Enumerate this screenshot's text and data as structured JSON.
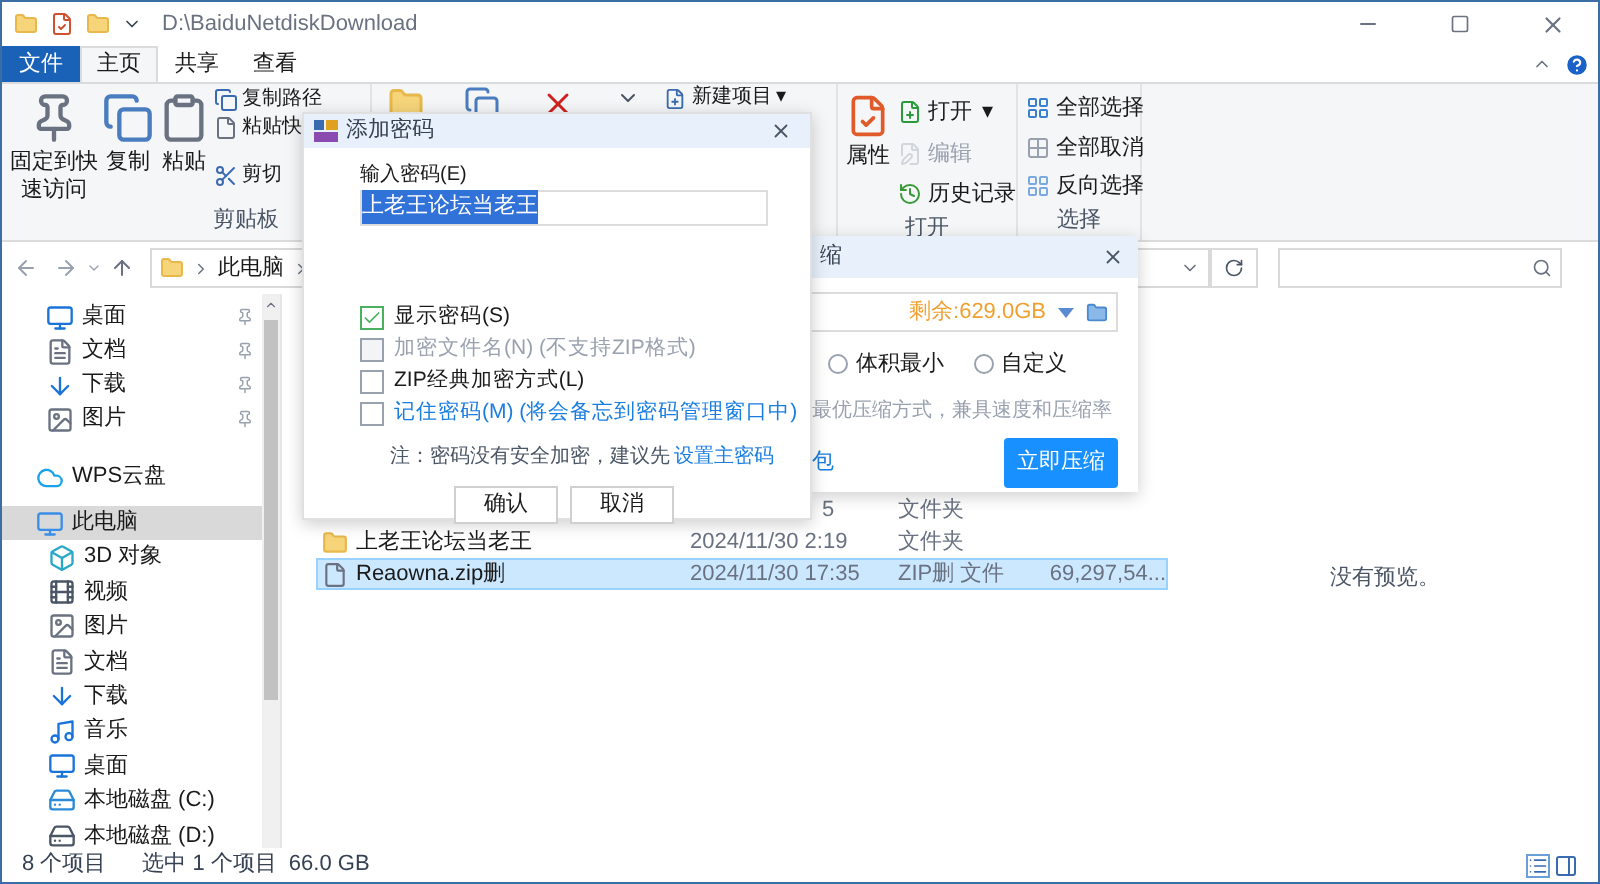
{
  "window": {
    "path": "D:\\BaiduNetdiskDownload"
  },
  "tabs": [
    {
      "label": "文件",
      "kind": "file",
      "selected": false
    },
    {
      "label": "主页",
      "kind": "tab",
      "selected": true
    },
    {
      "label": "共享",
      "kind": "tab",
      "selected": false
    },
    {
      "label": "查看",
      "kind": "tab",
      "selected": false
    }
  ],
  "ribbon": {
    "clipboard": {
      "label": "剪贴板",
      "large": [
        {
          "label": "固定到快速访问",
          "kind": "pin"
        },
        {
          "label": "复制",
          "kind": "copy"
        },
        {
          "label": "粘贴",
          "kind": "paste"
        }
      ],
      "small": [
        {
          "label": "复制路径",
          "kind": "path"
        },
        {
          "label": "粘贴快",
          "kind": "shortcut"
        },
        {
          "label": "剪切",
          "kind": "cut"
        }
      ]
    },
    "new_item": {
      "label": "新建项目",
      "caret": "▾"
    },
    "open": {
      "label": "打开",
      "properties": "属性",
      "items": [
        {
          "label": "打开",
          "kind": "open",
          "caret": "▾",
          "disabled": false
        },
        {
          "label": "编辑",
          "kind": "edit",
          "disabled": true
        },
        {
          "label": "历史记录",
          "kind": "history",
          "disabled": false
        }
      ]
    },
    "select": {
      "label": "选择",
      "items": [
        {
          "label": "全部选择",
          "kind": "all"
        },
        {
          "label": "全部取消",
          "kind": "none"
        },
        {
          "label": "反向选择",
          "kind": "invert"
        }
      ]
    }
  },
  "address": {
    "crumbs": [
      "此电脑"
    ]
  },
  "nav": {
    "quick": [
      {
        "label": "桌面",
        "kind": "desktop",
        "pinned": true
      },
      {
        "label": "文档",
        "kind": "doc",
        "pinned": true
      },
      {
        "label": "下载",
        "kind": "download",
        "pinned": true
      },
      {
        "label": "图片",
        "kind": "picture",
        "pinned": true
      }
    ],
    "items": [
      {
        "label": "WPS云盘",
        "kind": "cloud",
        "selected": false
      },
      {
        "label": "此电脑",
        "kind": "pc",
        "selected": true,
        "children": [
          {
            "label": "3D 对象",
            "kind": "cube"
          },
          {
            "label": "视频",
            "kind": "video"
          },
          {
            "label": "图片",
            "kind": "picture"
          },
          {
            "label": "文档",
            "kind": "doc"
          },
          {
            "label": "下载",
            "kind": "download"
          },
          {
            "label": "音乐",
            "kind": "music"
          },
          {
            "label": "桌面",
            "kind": "desktop"
          },
          {
            "label": "本地磁盘 (C:)",
            "kind": "system-disk"
          },
          {
            "label": "本地磁盘 (D:)",
            "kind": "disk"
          }
        ]
      }
    ]
  },
  "files": [
    {
      "kind": "hidden",
      "date": "5",
      "type": "文件夹",
      "selected": false
    },
    {
      "kind": "folder",
      "name": "上老王论坛当老王",
      "date": "2024/11/30 2:19",
      "type": "文件夹",
      "selected": false
    },
    {
      "kind": "file",
      "name": "Reaowna.zip删",
      "date": "2024/11/30 17:35",
      "type": "ZIP删 文件",
      "size": "69,297,54...",
      "selected": true
    }
  ],
  "preview": {
    "message": "没有预览。"
  },
  "status": {
    "count": "8 个项目",
    "selection": "选中 1 个项目",
    "size": "66.0 GB"
  },
  "password_dialog": {
    "title": "添加密码",
    "label": "输入密码(E)",
    "value": "上老王论坛当老王",
    "value_selected": true,
    "options": [
      {
        "label": "显示密码(S)",
        "kind": "plain",
        "checked": true,
        "disabled": false
      },
      {
        "label": "加密文件名(N) (不支持ZIP格式)",
        "kind": "plain",
        "checked": false,
        "disabled": true
      },
      {
        "label": "ZIP经典加密方式(L)",
        "kind": "plain",
        "checked": false,
        "disabled": false
      },
      {
        "label": "记住密码(M) (将会备忘到密码管理窗口中)",
        "kind": "link",
        "checked": false,
        "disabled": false
      }
    ],
    "note": "注：密码没有安全加密，建议先",
    "note_link": "设置主密码",
    "buttons": [
      "确认",
      "取消"
    ]
  },
  "compress_dialog": {
    "title": "缩",
    "free_space": "剩余:629.0GB",
    "modes": [
      {
        "label": "体积最小",
        "selected": false
      },
      {
        "label": "自定义",
        "selected": false
      }
    ],
    "hint": "最优压缩方式，兼具速度和压缩率",
    "link": "包",
    "button": "立即压缩"
  }
}
